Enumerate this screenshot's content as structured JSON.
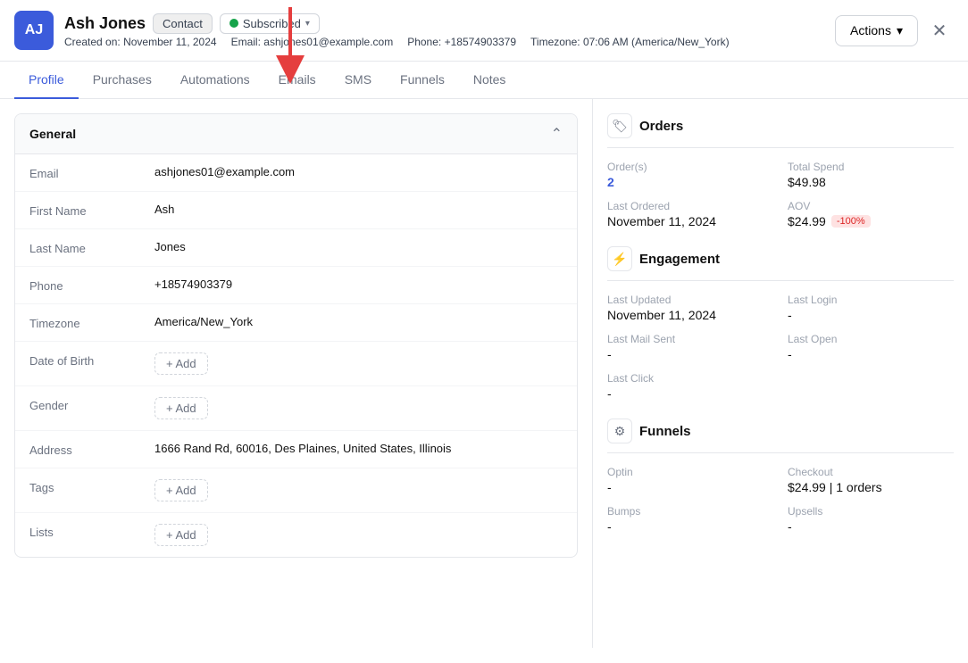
{
  "header": {
    "avatar_initials": "AJ",
    "name": "Ash Jones",
    "contact_label": "Contact",
    "subscribed_label": "Subscribed",
    "created_label": "Created on:",
    "created_date": "November 11, 2024",
    "email_label": "Email:",
    "email_value": "ashjones01@example.com",
    "phone_label": "Phone:",
    "phone_value": "+18574903379",
    "timezone_label": "Timezone:",
    "timezone_value": "07:06 AM (America/New_York)",
    "actions_label": "Actions",
    "close_icon": "✕"
  },
  "tabs": {
    "items": [
      {
        "label": "Profile",
        "active": true
      },
      {
        "label": "Purchases",
        "active": false
      },
      {
        "label": "Automations",
        "active": false
      },
      {
        "label": "Emails",
        "active": false
      },
      {
        "label": "SMS",
        "active": false
      },
      {
        "label": "Funnels",
        "active": false
      },
      {
        "label": "Notes",
        "active": false
      }
    ]
  },
  "general": {
    "title": "General",
    "fields": [
      {
        "label": "Email",
        "value": "ashjones01@example.com",
        "type": "text"
      },
      {
        "label": "First Name",
        "value": "Ash",
        "type": "text"
      },
      {
        "label": "Last Name",
        "value": "Jones",
        "type": "text"
      },
      {
        "label": "Phone",
        "value": "+18574903379",
        "type": "text"
      },
      {
        "label": "Timezone",
        "value": "America/New_York",
        "type": "text"
      },
      {
        "label": "Date of Birth",
        "value": null,
        "type": "add"
      },
      {
        "label": "Gender",
        "value": null,
        "type": "add"
      },
      {
        "label": "Address",
        "value": "1666 Rand Rd, 60016, Des Plaines, United States, Illinois",
        "type": "text"
      },
      {
        "label": "Tags",
        "value": null,
        "type": "add"
      },
      {
        "label": "Lists",
        "value": null,
        "type": "add"
      }
    ],
    "add_label": "+ Add"
  },
  "orders": {
    "title": "Orders",
    "orders_label": "Order(s)",
    "orders_value": "2",
    "total_spend_label": "Total Spend",
    "total_spend_value": "$49.98",
    "last_ordered_label": "Last Ordered",
    "last_ordered_value": "November 11, 2024",
    "aov_label": "AOV",
    "aov_value": "$24.99",
    "aov_badge": "-100%"
  },
  "engagement": {
    "title": "Engagement",
    "last_updated_label": "Last Updated",
    "last_updated_value": "November 11, 2024",
    "last_login_label": "Last Login",
    "last_login_value": "-",
    "last_mail_sent_label": "Last Mail Sent",
    "last_mail_sent_value": "-",
    "last_open_label": "Last Open",
    "last_open_value": "-",
    "last_click_label": "Last Click",
    "last_click_value": "-"
  },
  "funnels": {
    "title": "Funnels",
    "optin_label": "Optin",
    "optin_value": "-",
    "checkout_label": "Checkout",
    "checkout_value": "$24.99 | 1 orders",
    "bumps_label": "Bumps",
    "bumps_value": "-",
    "upsells_label": "Upsells",
    "upsells_value": "-"
  }
}
